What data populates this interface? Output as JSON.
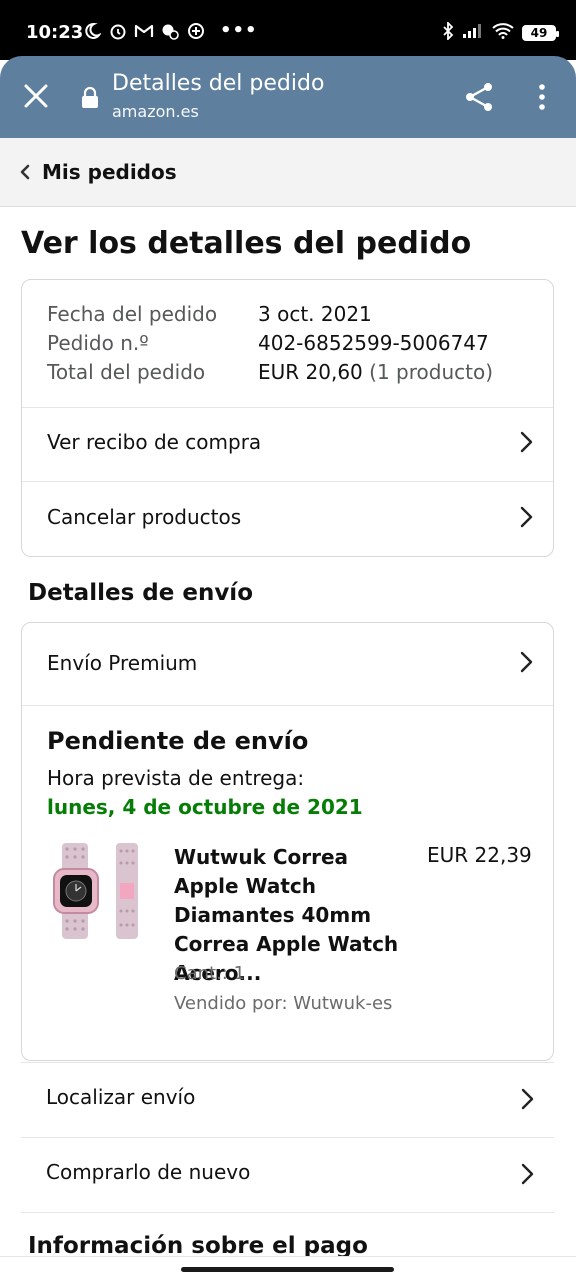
{
  "status_bar": {
    "time": "10:23",
    "more": "•••",
    "battery": "49",
    "icons_left": [
      "moon-icon",
      "alarm-icon",
      "gmail-icon",
      "data-saver-icon",
      "location-plus-icon"
    ],
    "icons_right": [
      "bluetooth-icon",
      "signal-icon",
      "wifi-icon",
      "battery-icon"
    ]
  },
  "browser": {
    "title": "Detalles del pedido",
    "url": "amazon.es"
  },
  "breadcrumb": {
    "label": "Mis pedidos"
  },
  "page_title": "Ver los detalles del pedido",
  "order": {
    "date_label": "Fecha del pedido",
    "date_value": "3 oct. 2021",
    "number_label": "Pedido n.º",
    "number_value": "402-6852599-5006747",
    "total_label": "Total del pedido",
    "total_value": "EUR 20,60",
    "total_count": "(1 producto)",
    "receipt_link": "Ver recibo de compra",
    "cancel_link": "Cancelar productos"
  },
  "shipping": {
    "section_title": "Detalles de envío",
    "method": "Envío Premium",
    "status": "Pendiente de envío",
    "eta_label": "Hora prevista de entrega:",
    "eta_date": "lunes, 4 de octubre de 2021",
    "product": {
      "title": "Wutwuk Correa Apple Watch Diamantes 40mm Correa Apple Watch Acero...",
      "price": "EUR 22,39",
      "qty": "Cant.: 1",
      "seller": "Vendido por: Wutwuk-es"
    }
  },
  "actions": {
    "track": "Localizar envío",
    "buy_again": "Comprarlo de nuevo"
  },
  "payment": {
    "section_title": "Información sobre el pago"
  },
  "colors": {
    "toolbar": "#5f7f9e",
    "delivery_green": "#067d06",
    "crumb_bg": "#f3f3f3"
  }
}
